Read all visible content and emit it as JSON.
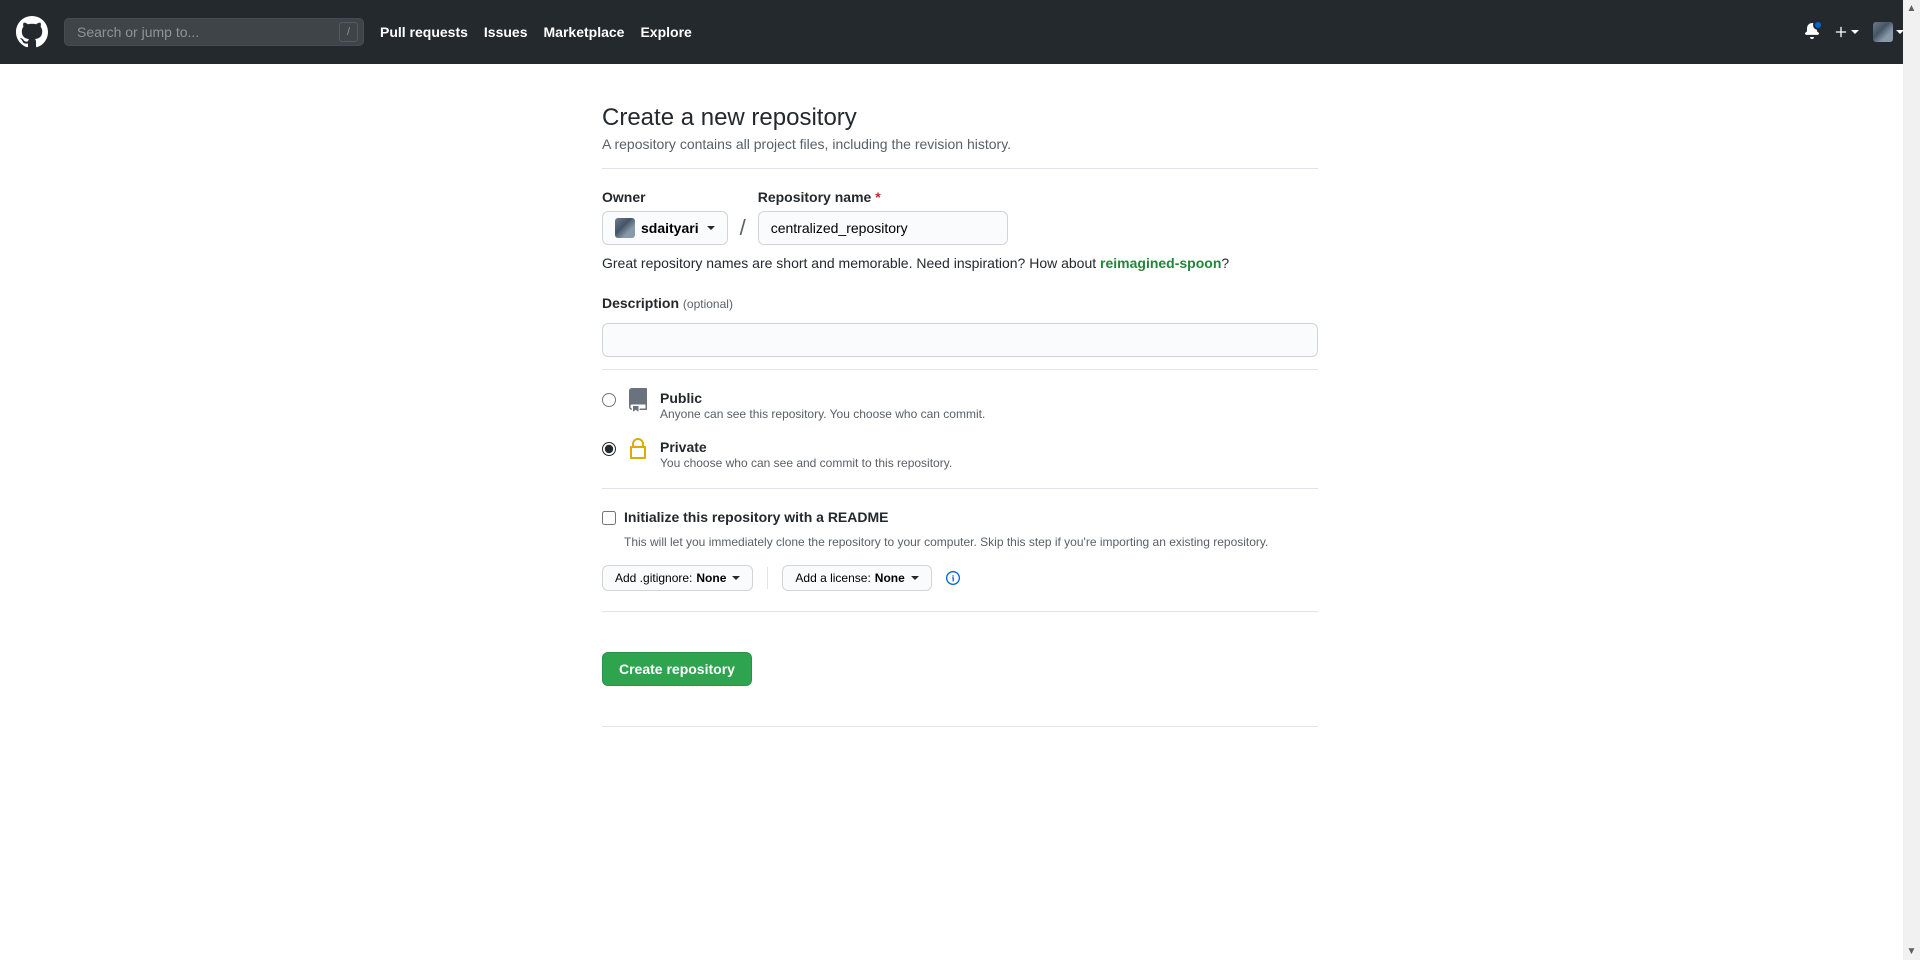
{
  "header": {
    "search_placeholder": "Search or jump to...",
    "nav": [
      "Pull requests",
      "Issues",
      "Marketplace",
      "Explore"
    ]
  },
  "page": {
    "title": "Create a new repository",
    "subtitle": "A repository contains all project files, including the revision history."
  },
  "form": {
    "owner_label": "Owner",
    "owner_value": "sdaityari",
    "name_label": "Repository name",
    "name_value": "centralized_repository",
    "hint_prefix": "Great repository names are short and memorable. Need inspiration? How about ",
    "hint_suggestion": "reimagined-spoon",
    "hint_suffix": "?",
    "desc_label": "Description",
    "desc_optional": "(optional)",
    "visibility": {
      "public": {
        "title": "Public",
        "note": "Anyone can see this repository. You choose who can commit."
      },
      "private": {
        "title": "Private",
        "note": "You choose who can see and commit to this repository."
      },
      "selected": "private"
    },
    "init": {
      "label": "Initialize this repository with a README",
      "note": "This will let you immediately clone the repository to your computer. Skip this step if you're importing an existing repository."
    },
    "gitignore_label": "Add .gitignore: ",
    "gitignore_value": "None",
    "license_label": "Add a license: ",
    "license_value": "None",
    "submit": "Create repository"
  }
}
